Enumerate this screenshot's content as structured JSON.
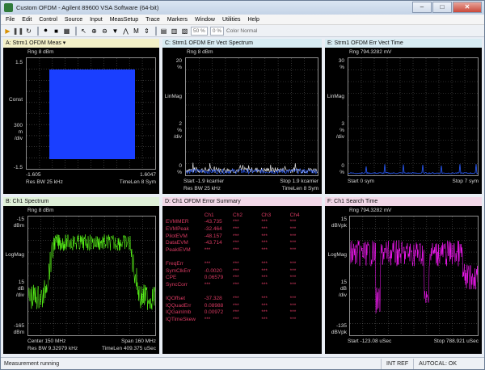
{
  "window": {
    "title": "Custom OFDM - Agilent 89600 VSA Software (64-bit)",
    "buttons": [
      "–",
      "□",
      "✕"
    ]
  },
  "menu": [
    "File",
    "Edit",
    "Control",
    "Source",
    "Input",
    "MeasSetup",
    "Trace",
    "Markers",
    "Window",
    "Utilities",
    "Help"
  ],
  "toolbar": {
    "zoom": "50 %",
    "percent": "0 %",
    "color_mode": "Color Normal"
  },
  "panels": {
    "a": {
      "title": "A: Strm1 OFDM Meas",
      "rng": "Rng 8 dBm",
      "ytop": "1.5",
      "ymid1": "Const",
      "ymid2": "300",
      "ymid3": "m",
      "ymid4": "/div",
      "ybot": "-1.5",
      "xleft": "-1.605",
      "xright": "1.6047",
      "foot_left": "Res BW 25 kHz",
      "foot_right": "TimeLen 8  Sym",
      "color": "#1a3fff"
    },
    "c": {
      "title": "C: Strm1 OFDM Err Vect Spectrum",
      "rng": "Rng 8 dBm",
      "ytop": "20",
      "ytop_u": "%",
      "ymid1": "LinMag",
      "ymid2": "2",
      "ymid3": "%",
      "ymid4": "/div",
      "ybot": "0",
      "ybot_u": "%",
      "xleft": "Start -1.9 kcarrier",
      "xright": "Stop 1.9 kcarrier",
      "foot_left": "Res BW 25 kHz",
      "foot_right": "TimeLen 8  Sym"
    },
    "e": {
      "title": "E: Strm1 OFDM Err Vect Time",
      "rng": "Rng 794.3282 mV",
      "ytop": "30",
      "ytop_u": "%",
      "ymid1": "LinMag",
      "ymid2": "3",
      "ymid3": "%",
      "ymid4": "/div",
      "ybot": "0",
      "ybot_u": "%",
      "xleft": "Start 0  sym",
      "xright": "Stop 7  sym"
    },
    "b": {
      "title": "B: Ch1 Spectrum",
      "rng": "Rng 8 dBm",
      "ytop": "-15",
      "ytop_u": "dBm",
      "ymid1": "LogMag",
      "ymid2": "15",
      "ymid3": "dB",
      "ymid4": "/div",
      "ybot": "-165",
      "ybot_u": "dBm",
      "xleft": "Center 150 MHz",
      "xright": "Span 160 MHz",
      "foot_left": "Res BW 9.32979 kHz",
      "foot_right": "TimeLen 409.375 uSec",
      "color": "#5cff1a"
    },
    "d": {
      "title": "D: Ch1 OFDM Error Summary",
      "headers": [
        "",
        "Ch1",
        "Ch2",
        "Ch3",
        "Ch4"
      ],
      "rows": [
        [
          "EVMMER",
          "-43.735",
          "***",
          "***",
          "***"
        ],
        [
          "EVMPeak",
          "-32.464",
          "***",
          "***",
          "***"
        ],
        [
          "PilotEVM",
          "-48.157",
          "***",
          "***",
          "***"
        ],
        [
          "DataEVM",
          "-43.714",
          "***",
          "***",
          "***"
        ],
        [
          "PeakIEVM",
          "***",
          "***",
          "***",
          "***"
        ],
        [
          "",
          "",
          "",
          "",
          ""
        ],
        [
          "FreqErr",
          "***",
          "***",
          "***",
          "***"
        ],
        [
          "SymClkErr",
          "-0.0020",
          "***",
          "***",
          "***"
        ],
        [
          "CPE",
          "0.06579",
          "***",
          "***",
          "***"
        ],
        [
          "SyncCorr",
          "***",
          "***",
          "***",
          "***"
        ],
        [
          "",
          "",
          "",
          "",
          ""
        ],
        [
          "IQOffset",
          "-37.328",
          "***",
          "***",
          "***"
        ],
        [
          "IQQuadErr",
          "0.08988",
          "***",
          "***",
          "***"
        ],
        [
          "IQGainImb",
          "0.00972",
          "***",
          "***",
          "***"
        ],
        [
          "IQTimeSkew",
          "***",
          "***",
          "***",
          "***"
        ]
      ]
    },
    "f": {
      "title": "F: Ch1 Search Time",
      "rng": "Rng 794.3282 mV",
      "ytop": "15",
      "ytop_u": "dBVpk",
      "ymid1": "LogMag",
      "ymid2": "15",
      "ymid3": "dB",
      "ymid4": "/div",
      "ybot": "-135",
      "ybot_u": "dBVpk",
      "xleft": "Start -123.08 uSec",
      "xright": "Stop 788.921 uSec",
      "color": "#ff1aff"
    }
  },
  "status": {
    "message": "Measurement running",
    "ref": "INT REF",
    "autocal": "AUTOCAL: OK"
  }
}
